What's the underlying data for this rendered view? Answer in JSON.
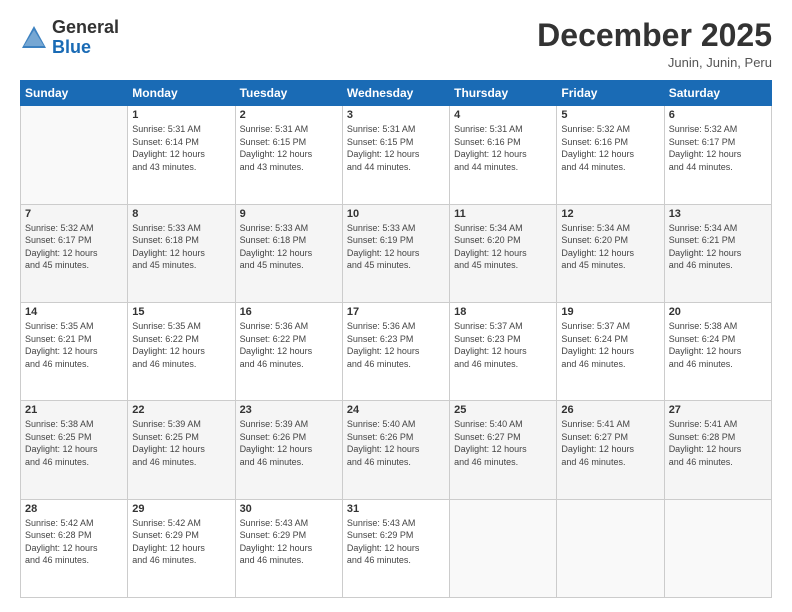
{
  "header": {
    "logo_general": "General",
    "logo_blue": "Blue",
    "month_title": "December 2025",
    "location": "Junin, Junin, Peru"
  },
  "days_of_week": [
    "Sunday",
    "Monday",
    "Tuesday",
    "Wednesday",
    "Thursday",
    "Friday",
    "Saturday"
  ],
  "weeks": [
    [
      {
        "day": "",
        "info": ""
      },
      {
        "day": "1",
        "info": "Sunrise: 5:31 AM\nSunset: 6:14 PM\nDaylight: 12 hours\nand 43 minutes."
      },
      {
        "day": "2",
        "info": "Sunrise: 5:31 AM\nSunset: 6:15 PM\nDaylight: 12 hours\nand 43 minutes."
      },
      {
        "day": "3",
        "info": "Sunrise: 5:31 AM\nSunset: 6:15 PM\nDaylight: 12 hours\nand 44 minutes."
      },
      {
        "day": "4",
        "info": "Sunrise: 5:31 AM\nSunset: 6:16 PM\nDaylight: 12 hours\nand 44 minutes."
      },
      {
        "day": "5",
        "info": "Sunrise: 5:32 AM\nSunset: 6:16 PM\nDaylight: 12 hours\nand 44 minutes."
      },
      {
        "day": "6",
        "info": "Sunrise: 5:32 AM\nSunset: 6:17 PM\nDaylight: 12 hours\nand 44 minutes."
      }
    ],
    [
      {
        "day": "7",
        "info": "Sunrise: 5:32 AM\nSunset: 6:17 PM\nDaylight: 12 hours\nand 45 minutes."
      },
      {
        "day": "8",
        "info": "Sunrise: 5:33 AM\nSunset: 6:18 PM\nDaylight: 12 hours\nand 45 minutes."
      },
      {
        "day": "9",
        "info": "Sunrise: 5:33 AM\nSunset: 6:18 PM\nDaylight: 12 hours\nand 45 minutes."
      },
      {
        "day": "10",
        "info": "Sunrise: 5:33 AM\nSunset: 6:19 PM\nDaylight: 12 hours\nand 45 minutes."
      },
      {
        "day": "11",
        "info": "Sunrise: 5:34 AM\nSunset: 6:20 PM\nDaylight: 12 hours\nand 45 minutes."
      },
      {
        "day": "12",
        "info": "Sunrise: 5:34 AM\nSunset: 6:20 PM\nDaylight: 12 hours\nand 45 minutes."
      },
      {
        "day": "13",
        "info": "Sunrise: 5:34 AM\nSunset: 6:21 PM\nDaylight: 12 hours\nand 46 minutes."
      }
    ],
    [
      {
        "day": "14",
        "info": "Sunrise: 5:35 AM\nSunset: 6:21 PM\nDaylight: 12 hours\nand 46 minutes."
      },
      {
        "day": "15",
        "info": "Sunrise: 5:35 AM\nSunset: 6:22 PM\nDaylight: 12 hours\nand 46 minutes."
      },
      {
        "day": "16",
        "info": "Sunrise: 5:36 AM\nSunset: 6:22 PM\nDaylight: 12 hours\nand 46 minutes."
      },
      {
        "day": "17",
        "info": "Sunrise: 5:36 AM\nSunset: 6:23 PM\nDaylight: 12 hours\nand 46 minutes."
      },
      {
        "day": "18",
        "info": "Sunrise: 5:37 AM\nSunset: 6:23 PM\nDaylight: 12 hours\nand 46 minutes."
      },
      {
        "day": "19",
        "info": "Sunrise: 5:37 AM\nSunset: 6:24 PM\nDaylight: 12 hours\nand 46 minutes."
      },
      {
        "day": "20",
        "info": "Sunrise: 5:38 AM\nSunset: 6:24 PM\nDaylight: 12 hours\nand 46 minutes."
      }
    ],
    [
      {
        "day": "21",
        "info": "Sunrise: 5:38 AM\nSunset: 6:25 PM\nDaylight: 12 hours\nand 46 minutes."
      },
      {
        "day": "22",
        "info": "Sunrise: 5:39 AM\nSunset: 6:25 PM\nDaylight: 12 hours\nand 46 minutes."
      },
      {
        "day": "23",
        "info": "Sunrise: 5:39 AM\nSunset: 6:26 PM\nDaylight: 12 hours\nand 46 minutes."
      },
      {
        "day": "24",
        "info": "Sunrise: 5:40 AM\nSunset: 6:26 PM\nDaylight: 12 hours\nand 46 minutes."
      },
      {
        "day": "25",
        "info": "Sunrise: 5:40 AM\nSunset: 6:27 PM\nDaylight: 12 hours\nand 46 minutes."
      },
      {
        "day": "26",
        "info": "Sunrise: 5:41 AM\nSunset: 6:27 PM\nDaylight: 12 hours\nand 46 minutes."
      },
      {
        "day": "27",
        "info": "Sunrise: 5:41 AM\nSunset: 6:28 PM\nDaylight: 12 hours\nand 46 minutes."
      }
    ],
    [
      {
        "day": "28",
        "info": "Sunrise: 5:42 AM\nSunset: 6:28 PM\nDaylight: 12 hours\nand 46 minutes."
      },
      {
        "day": "29",
        "info": "Sunrise: 5:42 AM\nSunset: 6:29 PM\nDaylight: 12 hours\nand 46 minutes."
      },
      {
        "day": "30",
        "info": "Sunrise: 5:43 AM\nSunset: 6:29 PM\nDaylight: 12 hours\nand 46 minutes."
      },
      {
        "day": "31",
        "info": "Sunrise: 5:43 AM\nSunset: 6:29 PM\nDaylight: 12 hours\nand 46 minutes."
      },
      {
        "day": "",
        "info": ""
      },
      {
        "day": "",
        "info": ""
      },
      {
        "day": "",
        "info": ""
      }
    ]
  ]
}
